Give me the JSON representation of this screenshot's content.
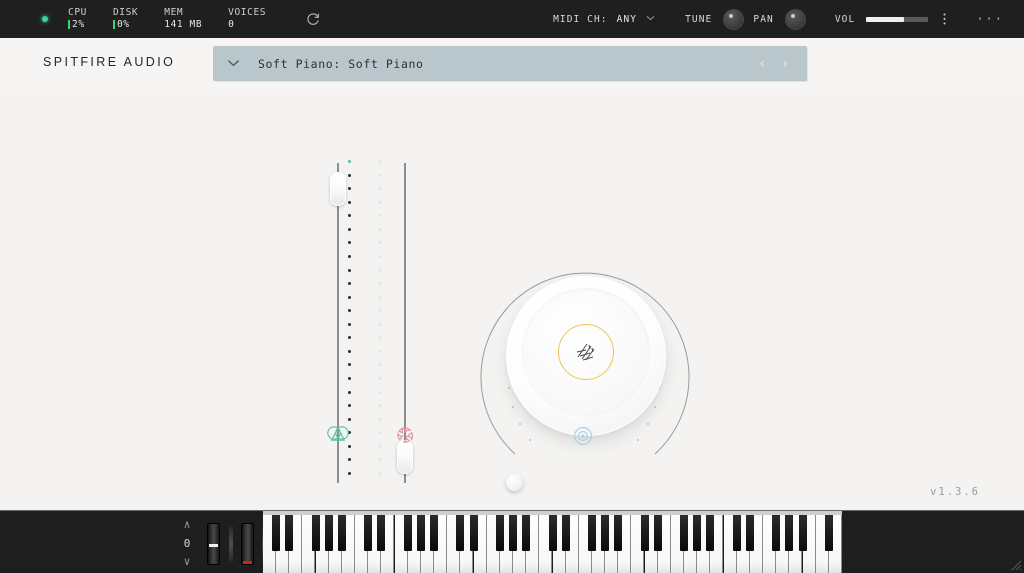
{
  "topbar": {
    "host_led": "active",
    "meters": [
      {
        "label": "CPU",
        "value": "2%"
      },
      {
        "label": "DISK",
        "value": "0%"
      },
      {
        "label": "MEM",
        "value": "141 MB"
      },
      {
        "label": "VOICES",
        "value": "0"
      }
    ],
    "reload_icon": "reload-icon",
    "midi_label": "MIDI CH:",
    "midi_value": "ANY",
    "tune_label": "TUNE",
    "pan_label": "PAN",
    "vol_label": "VOL",
    "vol_percent": 60,
    "more_label": "···"
  },
  "header": {
    "brand": "SPITFIRE AUDIO",
    "preset_name": "Soft Piano: Soft Piano",
    "prev_label": "‹",
    "next_label": "›"
  },
  "main": {
    "version": "v1.3.6",
    "sliders": [
      {
        "name": "dynamics",
        "value_pct": 97,
        "icon": "dynamics-icon",
        "color": "#4fc3a1"
      },
      {
        "name": "expression",
        "value_pct": 3,
        "icon": "expression-icon",
        "color": "#e8a0ab"
      }
    ],
    "knob": {
      "name": "reverb",
      "value_pct": 0,
      "icon": "reverb-icon",
      "center_icon": "texture-icon",
      "accent": "#e8c84e",
      "icon_color": "#9ccbe0"
    }
  },
  "keyboard": {
    "octave_value": "0",
    "octave_up": "∧",
    "octave_down": "∨",
    "pitch_wheel": {
      "name": "pitch-bend",
      "position_pct": 50,
      "color": "#f0f0f0"
    },
    "mod_wheel": {
      "name": "mod-wheel",
      "position_pct": 4,
      "color": "#cc2222"
    },
    "white_key_count": 44,
    "resize_grip": "resize-grip-icon"
  }
}
